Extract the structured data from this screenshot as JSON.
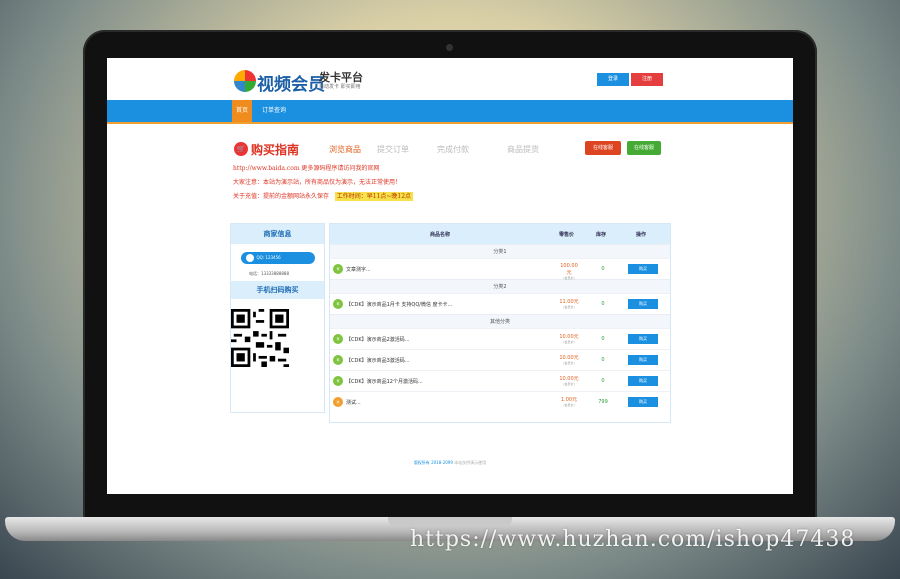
{
  "header": {
    "logo_text": "视频会员",
    "logo_sub": "发卡平台",
    "logo_tag": "自动发卡 即买即用",
    "login_label": "登录",
    "register_label": "注册"
  },
  "nav": {
    "home_label": "首页",
    "order_label": "订单查询"
  },
  "guide": {
    "title": "购买指南",
    "steps": [
      "浏览商品",
      "提交订单",
      "完成付款",
      "商品提货"
    ],
    "badge_red": "在线客服",
    "badge_green": "在线客服"
  },
  "notices": {
    "line1": "http://www.baida.com  更多源码程序请访问我的官网",
    "line2": "大家注意：本站为演示站，所有商品仅为演示，无法正常使用！",
    "line3_prefix": "关于充值：提前的金额网站永久保存",
    "line3_hours": "工作时间：早11点~晚12点"
  },
  "merchant": {
    "title": "商家信息",
    "qq": "QQ: 123456",
    "phone": "电话：13333888888",
    "scan_title": "手机扫码购买"
  },
  "table": {
    "col_name": "商品名称",
    "col_price": "零售价",
    "col_stock": "库存",
    "col_action": "操作",
    "categories": [
      {
        "name": "分类1",
        "rows": [
          {
            "icon": "荐",
            "name": "文章测字...",
            "price": "100.00元",
            "price_sub": "(会员价)",
            "stock": "0",
            "buy": "购买",
            "color": "green"
          }
        ]
      },
      {
        "name": "分类2",
        "rows": [
          {
            "icon": "荐",
            "name": "【CDK】演示商品1月卡 支持QQ/微信 度卡卡...",
            "price": "11.00元",
            "price_sub": "(会员价)",
            "stock": "0",
            "buy": "购买",
            "color": "green"
          }
        ]
      },
      {
        "name": "其他分类",
        "rows": [
          {
            "icon": "荐",
            "name": "【CDK】演示商品2激活码...",
            "price": "10.00元",
            "price_sub": "(会员价)",
            "stock": "0",
            "buy": "购买",
            "color": "green"
          },
          {
            "icon": "荐",
            "name": "【CDK】演示商品3激活码...",
            "price": "10.00元",
            "price_sub": "(会员价)",
            "stock": "0",
            "buy": "购买",
            "color": "green"
          },
          {
            "icon": "荐",
            "name": "【CDK】演示商品12个月激活码...",
            "price": "10.00元",
            "price_sub": "(会员价)",
            "stock": "0",
            "buy": "购买",
            "color": "green"
          },
          {
            "icon": "热",
            "name": "测试...",
            "price": "1.00元",
            "price_sub": "(会员价)",
            "stock": "799",
            "buy": "购买",
            "color": "orange"
          }
        ]
      }
    ]
  },
  "footer": {
    "text": "版权所有 2018-2099",
    "text2": "本站仅供演示使用"
  },
  "watermark": "https://www.huzhan.com/ishop47438"
}
